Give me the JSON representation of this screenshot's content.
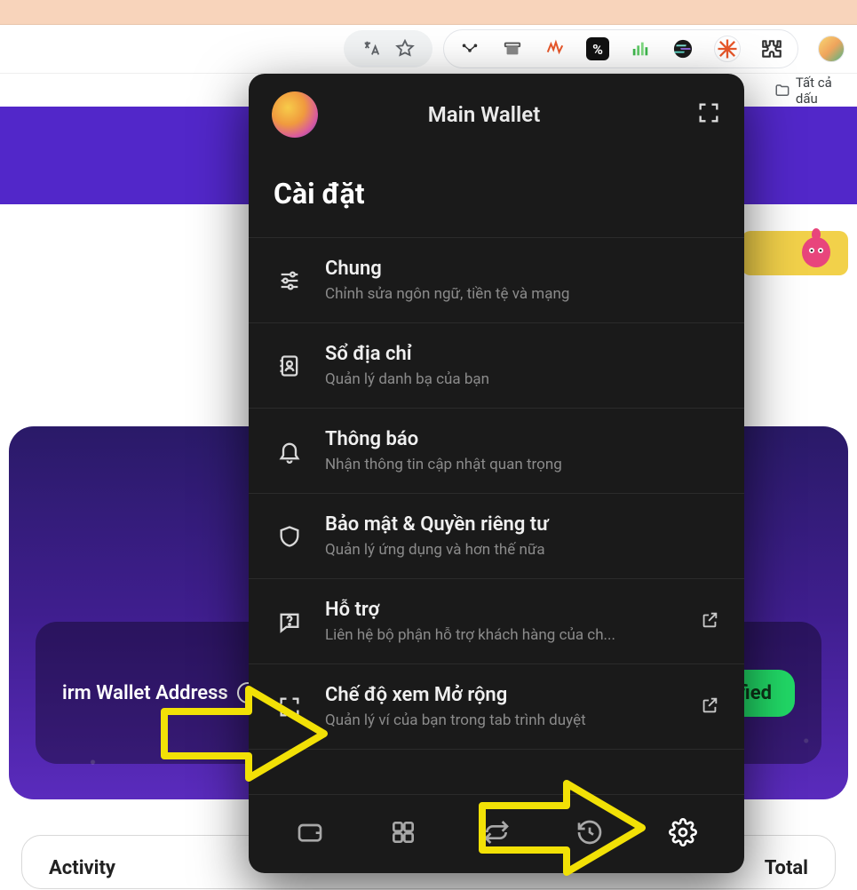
{
  "browser": {
    "bookmarks_label": "Tất cả dấu"
  },
  "popup": {
    "wallet_name": "Main Wallet",
    "settings_heading": "Cài đặt",
    "items": [
      {
        "title": "Chung",
        "sub": "Chỉnh sửa ngôn ngữ, tiền tệ và mạng"
      },
      {
        "title": "Sổ địa chỉ",
        "sub": "Quản lý danh bạ của bạn"
      },
      {
        "title": "Thông báo",
        "sub": "Nhận thông tin cập nhật quan trọng"
      },
      {
        "title": "Bảo mật & Quyền riêng tư",
        "sub": "Quản lý ứng dụng và hơn thế nữa"
      },
      {
        "title": "Hỗ trợ",
        "sub": "Liên hệ bộ phận hỗ trợ khách hàng của ch..."
      },
      {
        "title": "Chế độ xem Mở rộng",
        "sub": "Quản lý ví của bạn trong tab trình duyệt"
      }
    ]
  },
  "site": {
    "wallet_address_label": "irm Wallet Address",
    "verified_label": "ified",
    "activity_label": "Activity",
    "total_label": "Total"
  }
}
